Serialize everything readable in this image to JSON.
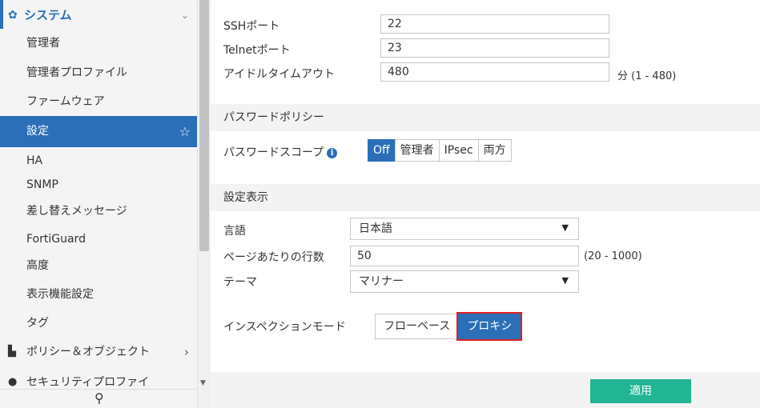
{
  "sidebar": {
    "header": {
      "label": "システム",
      "icon": "gear-icon",
      "chevron": "⌄"
    },
    "items": [
      {
        "label": "管理者"
      },
      {
        "label": "管理者プロファイル"
      },
      {
        "label": "ファームウェア"
      },
      {
        "label": "設定",
        "active": true
      },
      {
        "label": "HA"
      },
      {
        "label": "SNMP"
      },
      {
        "label": "差し替えメッセージ"
      },
      {
        "label": "FortiGuard"
      },
      {
        "label": "高度"
      },
      {
        "label": "表示機能設定"
      },
      {
        "label": "タグ"
      }
    ],
    "policy": {
      "label": "ポリシー＆オブジェクト",
      "chevron": "›"
    },
    "security": {
      "label": "セキュリティプロファイ"
    }
  },
  "admin_ports": {
    "ssh": {
      "label": "SSHポート",
      "value": "22"
    },
    "telnet": {
      "label": "Telnetポート",
      "value": "23"
    },
    "idle": {
      "label": "アイドルタイムアウト",
      "value": "480",
      "hint": "分 (1 - 480)"
    }
  },
  "password_policy": {
    "section": "パスワードポリシー",
    "scope_label": "パスワードスコープ",
    "options": [
      "Off",
      "管理者",
      "IPsec",
      "両方"
    ],
    "selected": "Off"
  },
  "view_settings": {
    "section": "設定表示",
    "language": {
      "label": "言語",
      "value": "日本語"
    },
    "rows": {
      "label": "ページあたりの行数",
      "value": "50",
      "hint": "(20 - 1000)"
    },
    "theme": {
      "label": "テーマ",
      "value": "マリナー"
    }
  },
  "inspection": {
    "label": "インスペクションモード",
    "options": [
      "フローベース",
      "プロキシ"
    ],
    "selected": "プロキシ"
  },
  "footer": {
    "apply_label": "適用"
  },
  "colors": {
    "accent": "#2a6fb8",
    "apply": "#22b594",
    "highlight": "#e02020"
  }
}
